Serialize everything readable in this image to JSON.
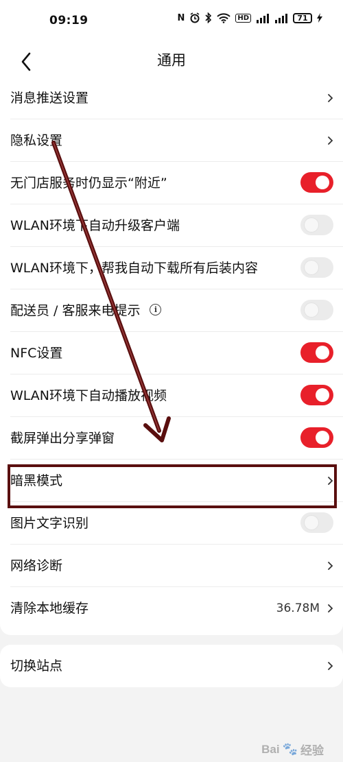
{
  "status_bar": {
    "time": "09:19",
    "nfc": "N",
    "hd": "HD",
    "battery": "71"
  },
  "header": {
    "title": "通用"
  },
  "settings": [
    {
      "label": "消息推送设置",
      "control": "chevron"
    },
    {
      "label": "隐私设置",
      "control": "chevron"
    },
    {
      "label": "无门店服务时仍显示“附近”",
      "control": "toggle",
      "on": true
    },
    {
      "label": "WLAN环境下自动升级客户端",
      "control": "toggle",
      "on": false
    },
    {
      "label": "WLAN环境下，帮我自动下载所有后装内容",
      "control": "toggle",
      "on": false
    },
    {
      "label": "配送员 / 客服来电提示",
      "control": "toggle",
      "on": false,
      "info": "i"
    },
    {
      "label": "NFC设置",
      "control": "toggle",
      "on": true
    },
    {
      "label": "WLAN环境下自动播放视频",
      "control": "toggle",
      "on": true
    },
    {
      "label": "截屏弹出分享弹窗",
      "control": "toggle",
      "on": true
    },
    {
      "label": "暗黑模式",
      "control": "chevron",
      "highlighted": true
    },
    {
      "label": "图片文字识别",
      "control": "toggle",
      "on": false
    },
    {
      "label": "网络诊断",
      "control": "chevron"
    },
    {
      "label": "清除本地缓存",
      "control": "chevron",
      "value": "36.78M"
    }
  ],
  "site": {
    "label": "切换站点"
  },
  "watermark": {
    "text": "Bai",
    "text2": "经验"
  },
  "colors": {
    "accent": "#e8202a",
    "annotation": "#5a0f0f",
    "background": "#f3f3f3"
  }
}
